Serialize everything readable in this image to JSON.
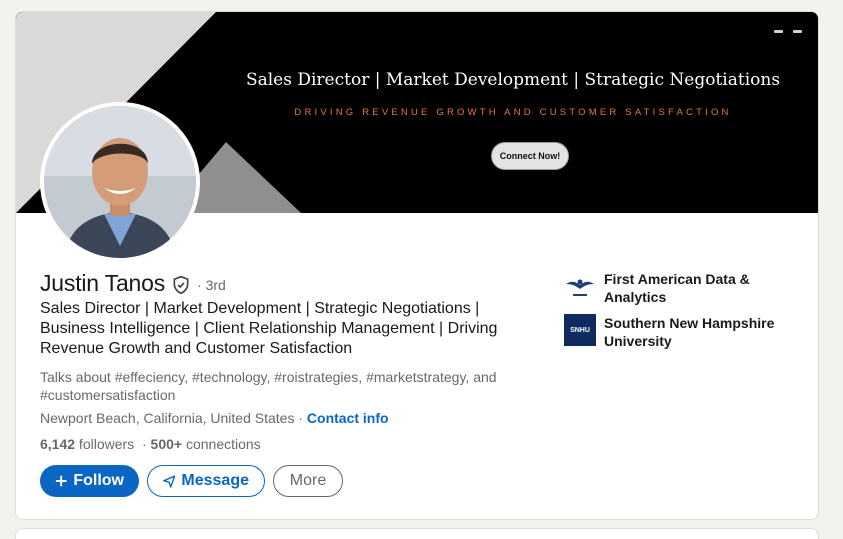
{
  "profile": {
    "name": "Justin Tanos",
    "degree": "· 3rd",
    "headline": "Sales Director | Market Development | Strategic Negotiations | Business Intelligence | Client Relationship Management | Driving Revenue Growth and Customer Satisfaction",
    "talks_about": "Talks about #effeciency, #technology, #roistrategies, #marketstrategy, and #customersatisfaction",
    "location": "Newport Beach, California, United States",
    "location_separator": " · ",
    "contact_info": "Contact info",
    "followers_count": "6,142",
    "followers_label": " followers",
    "stats_separator": "· ",
    "connections_count": "500+",
    "connections_label": " connections"
  },
  "banner": {
    "title": "Sales Director | Market Development | Strategic Negotiations",
    "tagline": "DRIVING REVENUE GROWTH AND CUSTOMER SATISFACTION",
    "cta": "Connect Now!"
  },
  "actions": {
    "follow": "Follow",
    "message": "Message",
    "more": "More"
  },
  "organizations": [
    {
      "name": "First American Data & Analytics",
      "logo": "eagle-logo"
    },
    {
      "name": "Southern New Hampshire University",
      "logo": "snhu-logo",
      "logo_text": "SNHU"
    }
  ],
  "colors": {
    "accent": "#0a66c2",
    "banner_accent": "#e8743b",
    "page_bg": "#f4f2ee"
  }
}
